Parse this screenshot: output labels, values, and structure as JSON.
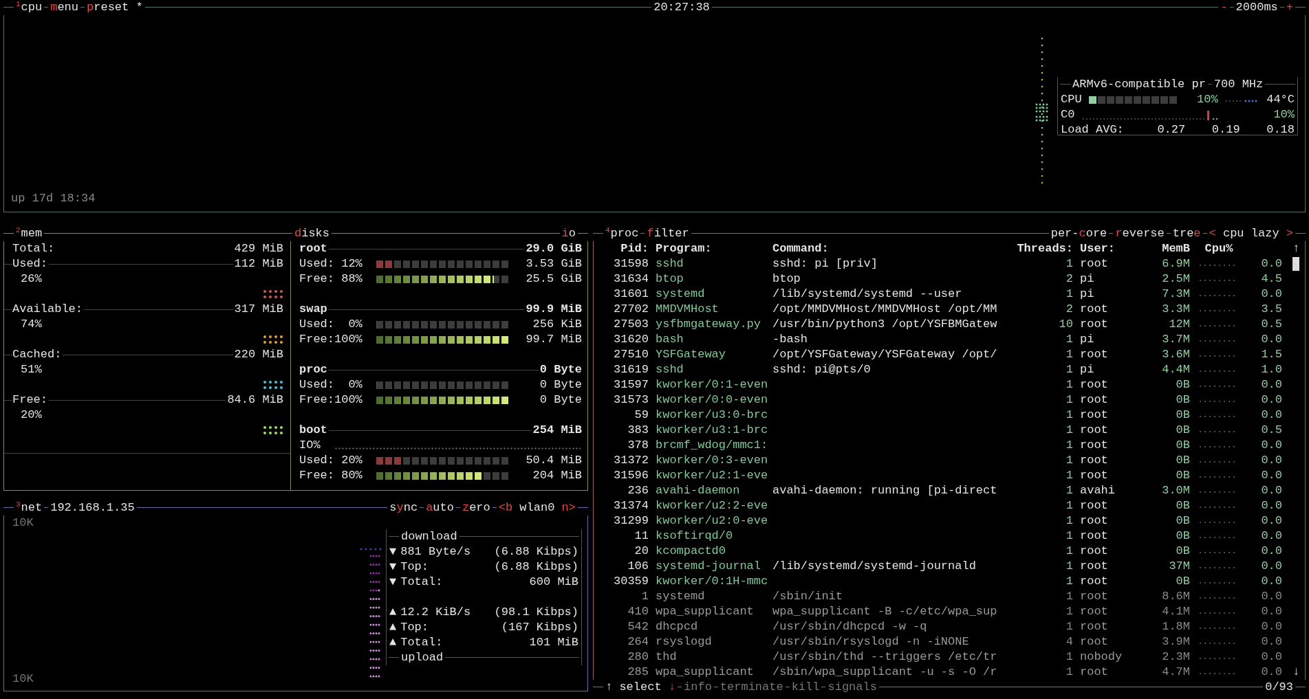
{
  "cpu": {
    "tabs": [
      {
        "number": "1",
        "segments": [
          {
            "text": "cpu",
            "hot": false
          }
        ]
      },
      {
        "segments": [
          {
            "text": "m",
            "hot": true
          },
          {
            "text": "enu",
            "hot": false
          }
        ]
      },
      {
        "segments": [
          {
            "text": "p",
            "hot": true
          },
          {
            "text": "reset *",
            "hot": false
          }
        ]
      }
    ],
    "clock": "20:27:38",
    "interval": {
      "minus": "-",
      "value": "2000ms",
      "plus": "+"
    },
    "uptime": "up 17d 18:34",
    "info": {
      "model": "ARMv6-compatible pr",
      "freq": "700 MHz",
      "cpu_label": "CPU",
      "level": 0.1,
      "cpu_pct": "10%",
      "temp": "44°C",
      "core_label": "C0",
      "core_pct": "10%",
      "load_label": "Load AVG:",
      "load": [
        "0.27",
        "0.19",
        "0.18"
      ]
    }
  },
  "mem": {
    "tab": {
      "number": "2",
      "segments": [
        {
          "text": "mem",
          "hot": false
        }
      ]
    },
    "total": {
      "label": "Total:",
      "value": "429 MiB"
    },
    "items": [
      {
        "label": "Used:",
        "value": "112 MiB",
        "pct": "26%",
        "color": "#d45a5a"
      },
      {
        "label": "Available:",
        "value": "317 MiB",
        "pct": "74%",
        "color": "#e8a040"
      },
      {
        "label": "Cached:",
        "value": "220 MiB",
        "pct": "51%",
        "color": "#40c8e0"
      },
      {
        "label": "Free:",
        "value": "84.6 MiB",
        "pct": "20%",
        "color": "#a0e060"
      }
    ]
  },
  "disks": {
    "tab": {
      "segments": [
        {
          "text": "d",
          "hot": true
        },
        {
          "text": "isks",
          "hot": false
        }
      ]
    },
    "io_tab": {
      "segments": [
        {
          "text": "i",
          "hot": true
        },
        {
          "text": "o",
          "hot": false
        }
      ]
    },
    "items": [
      {
        "name": "root",
        "total": "29.0 GiB",
        "used_label": "Used: 12%",
        "used_bar": {
          "level": 0.12
        },
        "used": "3.53 GiB",
        "free_label": "Free: 88%",
        "free_bar": {
          "level": 0.88
        },
        "free": "25.5 GiB"
      },
      {
        "name": "swap",
        "total": "99.9 MiB",
        "used_label": "Used:  0%",
        "used_bar": {
          "level": 0
        },
        "used": "256 KiB",
        "free_label": "Free:100%",
        "free_bar": {
          "level": 1
        },
        "free": "99.7 MiB"
      },
      {
        "name": "proc",
        "total": "0 Byte",
        "used_label": "Used:  0%",
        "used_bar": {
          "level": 0
        },
        "used": "0 Byte",
        "free_label": "Free:100%",
        "free_bar": {
          "level": 1
        },
        "free": "0 Byte"
      },
      {
        "name": "boot",
        "total": "254 MiB",
        "io_label": "IO%",
        "used_label": "Used: 20%",
        "used_bar": {
          "level": 0.2
        },
        "used": "50.4 MiB",
        "free_label": "Free: 80%",
        "free_bar": {
          "level": 0.8
        },
        "free": "204 MiB"
      }
    ]
  },
  "net": {
    "tabs": [
      {
        "number": "3",
        "segments": [
          {
            "text": "net",
            "hot": false
          }
        ]
      },
      {
        "segments": [
          {
            "text": "192.168.1.35",
            "hot": false
          }
        ]
      }
    ],
    "right_tabs": [
      {
        "segments": [
          {
            "text": "s",
            "hot": false
          },
          {
            "text": "y",
            "hot": true
          },
          {
            "text": "nc",
            "hot": false
          }
        ]
      },
      {
        "segments": [
          {
            "text": "a",
            "hot": true
          },
          {
            "text": "uto",
            "hot": false
          }
        ]
      },
      {
        "segments": [
          {
            "text": "z",
            "hot": true
          },
          {
            "text": "ero",
            "hot": false
          }
        ]
      },
      {
        "segments": [
          {
            "text": "<b",
            "hot": true
          },
          {
            "text": " wlan0 ",
            "hot": false
          },
          {
            "text": "n>",
            "hot": true
          }
        ]
      }
    ],
    "scale_top": "10K",
    "scale_bottom": "10K",
    "download": {
      "title": "download",
      "rows": [
        {
          "arrow": "▼",
          "label": "881 Byte/s",
          "value": "(6.88 Kibps)"
        },
        {
          "arrow": "▼",
          "label": "Top:",
          "value": "(6.88 Kibps)"
        },
        {
          "arrow": "▼",
          "label": "Total:",
          "value": "600 MiB"
        }
      ]
    },
    "upload": {
      "title": "upload",
      "rows": [
        {
          "arrow": "▲",
          "label": "12.2 KiB/s",
          "value": "(98.1 Kibps)"
        },
        {
          "arrow": "▲",
          "label": "Top:",
          "value": "(167 Kibps)"
        },
        {
          "arrow": "▲",
          "label": "Total:",
          "value": "101 MiB"
        }
      ]
    }
  },
  "proc": {
    "tabs": [
      {
        "number": "4",
        "segments": [
          {
            "text": "proc",
            "hot": false
          }
        ]
      },
      {
        "segments": [
          {
            "text": "f",
            "hot": true
          },
          {
            "text": "ilter",
            "hot": false
          }
        ]
      }
    ],
    "right_tabs": [
      {
        "segments": [
          {
            "text": "per-",
            "hot": false
          },
          {
            "text": "c",
            "hot": true
          },
          {
            "text": "ore",
            "hot": false
          }
        ]
      },
      {
        "segments": [
          {
            "text": "r",
            "hot": true
          },
          {
            "text": "everse",
            "hot": false
          }
        ]
      },
      {
        "segments": [
          {
            "text": "tre",
            "hot": false
          },
          {
            "text": "e",
            "hot": true
          }
        ]
      },
      {
        "segments": [
          {
            "text": "<",
            "hot": true
          },
          {
            "text": " cpu lazy ",
            "hot": false
          },
          {
            "text": ">",
            "hot": true
          }
        ]
      }
    ],
    "columns": [
      "Pid:",
      "Program:",
      "Command:",
      "Threads:",
      "User:",
      "MemB",
      "Cpu%"
    ],
    "scroll_up": "↑",
    "scroll_down": "↓",
    "rows": [
      {
        "pid": "31598",
        "program": "sshd",
        "command": "sshd: pi [priv]",
        "threads": "1",
        "user": "root",
        "mem": "6.9M",
        "cpu": "0.0",
        "dim": false
      },
      {
        "pid": "31634",
        "program": "btop",
        "command": "btop",
        "threads": "2",
        "user": "pi",
        "mem": "2.5M",
        "cpu": "4.5",
        "dim": false
      },
      {
        "pid": "31601",
        "program": "systemd",
        "command": "/lib/systemd/systemd --user",
        "threads": "1",
        "user": "pi",
        "mem": "7.3M",
        "cpu": "0.0",
        "dim": false
      },
      {
        "pid": "27702",
        "program": "MMDVMHost",
        "command": "/opt/MMDVMHost/MMDVMHost /opt/MM",
        "threads": "2",
        "user": "root",
        "mem": "3.3M",
        "cpu": "3.5",
        "dim": false
      },
      {
        "pid": "27503",
        "program": "ysfbmgateway.py",
        "command": "/usr/bin/python3 /opt/YSFBMGatew",
        "threads": "10",
        "user": "root",
        "mem": "12M",
        "cpu": "0.5",
        "dim": false
      },
      {
        "pid": "31620",
        "program": "bash",
        "command": "-bash",
        "threads": "1",
        "user": "pi",
        "mem": "3.7M",
        "cpu": "0.0",
        "dim": false
      },
      {
        "pid": "27510",
        "program": "YSFGateway",
        "command": "/opt/YSFGateway/YSFGateway /opt/",
        "threads": "1",
        "user": "root",
        "mem": "3.6M",
        "cpu": "1.5",
        "dim": false
      },
      {
        "pid": "31619",
        "program": "sshd",
        "command": "sshd: pi@pts/0",
        "threads": "1",
        "user": "pi",
        "mem": "4.4M",
        "cpu": "1.0",
        "dim": false
      },
      {
        "pid": "31597",
        "program": "kworker/0:1-even",
        "threads": "1",
        "user": "root",
        "mem": "0B",
        "cpu": "0.0",
        "dim": false
      },
      {
        "pid": "31573",
        "program": "kworker/0:0-even",
        "threads": "1",
        "user": "root",
        "mem": "0B",
        "cpu": "0.0",
        "dim": false
      },
      {
        "pid": "59",
        "program": "kworker/u3:0-brc",
        "threads": "1",
        "user": "root",
        "mem": "0B",
        "cpu": "0.0",
        "dim": false
      },
      {
        "pid": "383",
        "program": "kworker/u3:1-brc",
        "threads": "1",
        "user": "root",
        "mem": "0B",
        "cpu": "0.5",
        "dim": false
      },
      {
        "pid": "378",
        "program": "brcmf_wdog/mmc1:",
        "threads": "1",
        "user": "root",
        "mem": "0B",
        "cpu": "0.0",
        "dim": false
      },
      {
        "pid": "31372",
        "program": "kworker/0:3-even",
        "threads": "1",
        "user": "root",
        "mem": "0B",
        "cpu": "0.0",
        "dim": false
      },
      {
        "pid": "31596",
        "program": "kworker/u2:1-eve",
        "threads": "1",
        "user": "root",
        "mem": "0B",
        "cpu": "0.0",
        "dim": false
      },
      {
        "pid": "236",
        "program": "avahi-daemon",
        "command": "avahi-daemon: running [pi-direct",
        "threads": "1",
        "user": "avahi",
        "mem": "3.0M",
        "cpu": "0.0",
        "dim": false
      },
      {
        "pid": "31374",
        "program": "kworker/u2:2-eve",
        "threads": "1",
        "user": "root",
        "mem": "0B",
        "cpu": "0.0",
        "dim": false
      },
      {
        "pid": "31299",
        "program": "kworker/u2:0-eve",
        "threads": "1",
        "user": "root",
        "mem": "0B",
        "cpu": "0.0",
        "dim": false
      },
      {
        "pid": "11",
        "program": "ksoftirqd/0",
        "threads": "1",
        "user": "root",
        "mem": "0B",
        "cpu": "0.0",
        "dim": false
      },
      {
        "pid": "20",
        "program": "kcompactd0",
        "threads": "1",
        "user": "root",
        "mem": "0B",
        "cpu": "0.0",
        "dim": false
      },
      {
        "pid": "106",
        "program": "systemd-journal",
        "command": "/lib/systemd/systemd-journald",
        "threads": "1",
        "user": "root",
        "mem": "37M",
        "cpu": "0.0",
        "dim": false
      },
      {
        "pid": "30359",
        "program": "kworker/0:1H-mmc",
        "threads": "1",
        "user": "root",
        "mem": "0B",
        "cpu": "0.0",
        "dim": false
      },
      {
        "pid": "1",
        "program": "systemd",
        "command": "/sbin/init",
        "threads": "1",
        "user": "root",
        "mem": "8.6M",
        "cpu": "0.0",
        "dim": true
      },
      {
        "pid": "410",
        "program": "wpa_supplicant",
        "command": "wpa_supplicant -B -c/etc/wpa_sup",
        "threads": "1",
        "user": "root",
        "mem": "4.1M",
        "cpu": "0.0",
        "dim": true
      },
      {
        "pid": "542",
        "program": "dhcpcd",
        "command": "/usr/sbin/dhcpcd -w -q",
        "threads": "1",
        "user": "root",
        "mem": "1.8M",
        "cpu": "0.0",
        "dim": true
      },
      {
        "pid": "264",
        "program": "rsyslogd",
        "command": "/usr/sbin/rsyslogd -n -iNONE",
        "threads": "4",
        "user": "root",
        "mem": "3.9M",
        "cpu": "0.0",
        "dim": true
      },
      {
        "pid": "280",
        "program": "thd",
        "command": "/usr/sbin/thd --triggers /etc/tr",
        "threads": "1",
        "user": "nobody",
        "mem": "2.3M",
        "cpu": "0.0",
        "dim": true
      },
      {
        "pid": "285",
        "program": "wpa_supplicant",
        "command": "/sbin/wpa_supplicant -u -s -O /r",
        "threads": "1",
        "user": "root",
        "mem": "4.7M",
        "cpu": "0.0",
        "dim": true
      }
    ],
    "footer": [
      {
        "segments": [
          {
            "text": "↑ select ",
            "hot": false
          },
          {
            "text": "↓",
            "hot": true
          }
        ],
        "disabled": false
      },
      {
        "segments": [
          {
            "text": "info",
            "hot": false
          }
        ],
        "disabled": true
      },
      {
        "segments": [
          {
            "text": "terminate",
            "hot": false
          }
        ],
        "disabled": true
      },
      {
        "segments": [
          {
            "text": "kill",
            "hot": false
          }
        ],
        "disabled": true
      },
      {
        "segments": [
          {
            "text": "signals",
            "hot": false
          }
        ],
        "disabled": true
      }
    ],
    "count": "0/93"
  }
}
